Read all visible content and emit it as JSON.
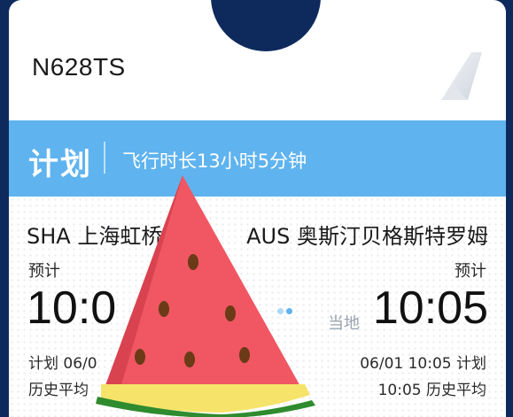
{
  "flight": {
    "tail_number": "N628TS",
    "status": "计划",
    "duration": "飞行时长13小时5分钟"
  },
  "departure": {
    "airport": "SHA 上海虹桥",
    "estimate_label": "预计",
    "time": "10:0",
    "plan": "计划 06/0",
    "history": "历史平均"
  },
  "arrival": {
    "airport": "AUS 奥斯汀贝格斯特罗姆",
    "estimate_label": "预计",
    "time": "10:05",
    "local_label": "当地",
    "plan": "06/01 10:05 计划",
    "history": "10:05 历史平均"
  },
  "colors": {
    "status_bar": "#5fb3ef",
    "background": "#0e2a5c",
    "watermelon_flesh": "#f05763",
    "watermelon_rind": "#2e8b2e"
  },
  "icons": [
    "airline-tail-logo-icon",
    "watermelon-sticker-icon"
  ]
}
